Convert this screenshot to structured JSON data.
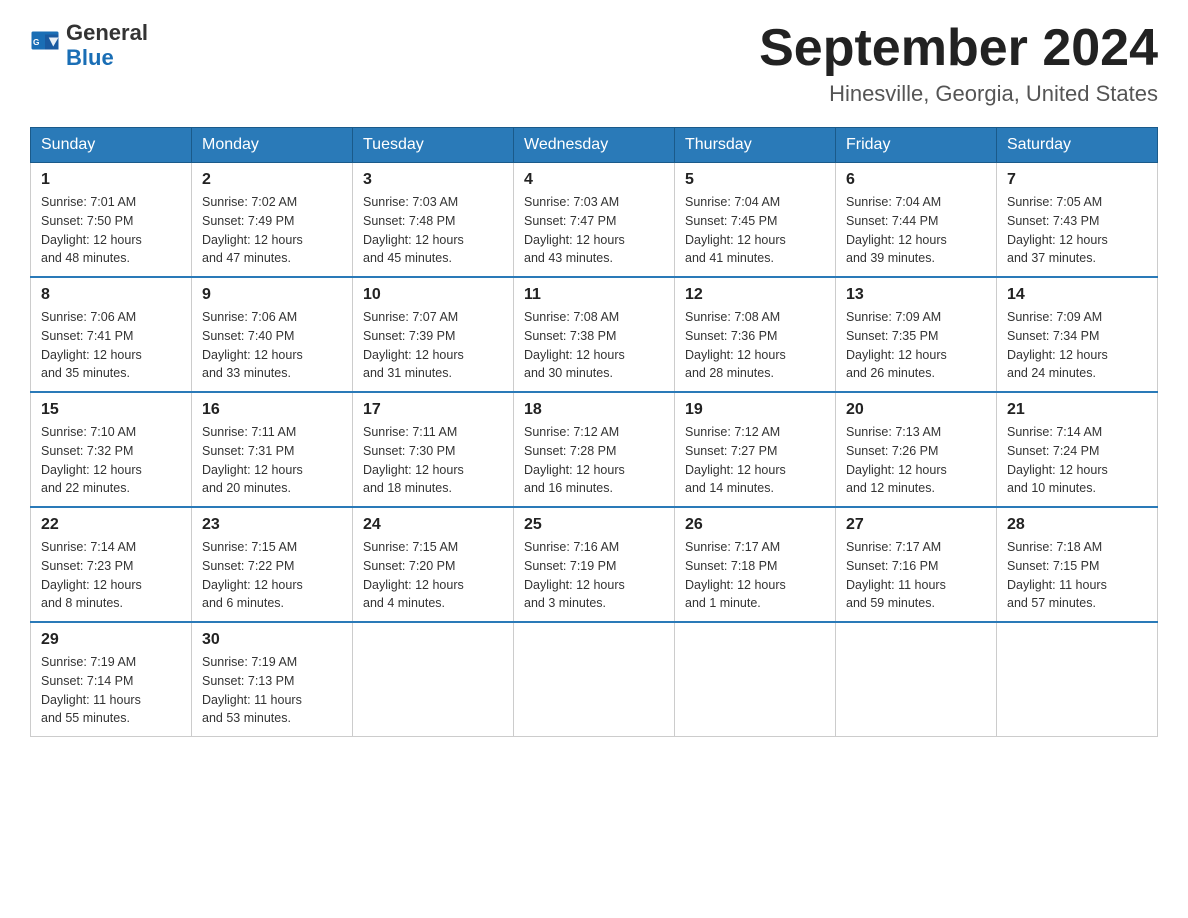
{
  "header": {
    "logo_line1": "General",
    "logo_line2": "Blue",
    "calendar_title": "September 2024",
    "calendar_subtitle": "Hinesville, Georgia, United States"
  },
  "days_of_week": [
    "Sunday",
    "Monday",
    "Tuesday",
    "Wednesday",
    "Thursday",
    "Friday",
    "Saturday"
  ],
  "weeks": [
    [
      {
        "day": "1",
        "sunrise": "7:01 AM",
        "sunset": "7:50 PM",
        "daylight": "12 hours and 48 minutes."
      },
      {
        "day": "2",
        "sunrise": "7:02 AM",
        "sunset": "7:49 PM",
        "daylight": "12 hours and 47 minutes."
      },
      {
        "day": "3",
        "sunrise": "7:03 AM",
        "sunset": "7:48 PM",
        "daylight": "12 hours and 45 minutes."
      },
      {
        "day": "4",
        "sunrise": "7:03 AM",
        "sunset": "7:47 PM",
        "daylight": "12 hours and 43 minutes."
      },
      {
        "day": "5",
        "sunrise": "7:04 AM",
        "sunset": "7:45 PM",
        "daylight": "12 hours and 41 minutes."
      },
      {
        "day": "6",
        "sunrise": "7:04 AM",
        "sunset": "7:44 PM",
        "daylight": "12 hours and 39 minutes."
      },
      {
        "day": "7",
        "sunrise": "7:05 AM",
        "sunset": "7:43 PM",
        "daylight": "12 hours and 37 minutes."
      }
    ],
    [
      {
        "day": "8",
        "sunrise": "7:06 AM",
        "sunset": "7:41 PM",
        "daylight": "12 hours and 35 minutes."
      },
      {
        "day": "9",
        "sunrise": "7:06 AM",
        "sunset": "7:40 PM",
        "daylight": "12 hours and 33 minutes."
      },
      {
        "day": "10",
        "sunrise": "7:07 AM",
        "sunset": "7:39 PM",
        "daylight": "12 hours and 31 minutes."
      },
      {
        "day": "11",
        "sunrise": "7:08 AM",
        "sunset": "7:38 PM",
        "daylight": "12 hours and 30 minutes."
      },
      {
        "day": "12",
        "sunrise": "7:08 AM",
        "sunset": "7:36 PM",
        "daylight": "12 hours and 28 minutes."
      },
      {
        "day": "13",
        "sunrise": "7:09 AM",
        "sunset": "7:35 PM",
        "daylight": "12 hours and 26 minutes."
      },
      {
        "day": "14",
        "sunrise": "7:09 AM",
        "sunset": "7:34 PM",
        "daylight": "12 hours and 24 minutes."
      }
    ],
    [
      {
        "day": "15",
        "sunrise": "7:10 AM",
        "sunset": "7:32 PM",
        "daylight": "12 hours and 22 minutes."
      },
      {
        "day": "16",
        "sunrise": "7:11 AM",
        "sunset": "7:31 PM",
        "daylight": "12 hours and 20 minutes."
      },
      {
        "day": "17",
        "sunrise": "7:11 AM",
        "sunset": "7:30 PM",
        "daylight": "12 hours and 18 minutes."
      },
      {
        "day": "18",
        "sunrise": "7:12 AM",
        "sunset": "7:28 PM",
        "daylight": "12 hours and 16 minutes."
      },
      {
        "day": "19",
        "sunrise": "7:12 AM",
        "sunset": "7:27 PM",
        "daylight": "12 hours and 14 minutes."
      },
      {
        "day": "20",
        "sunrise": "7:13 AM",
        "sunset": "7:26 PM",
        "daylight": "12 hours and 12 minutes."
      },
      {
        "day": "21",
        "sunrise": "7:14 AM",
        "sunset": "7:24 PM",
        "daylight": "12 hours and 10 minutes."
      }
    ],
    [
      {
        "day": "22",
        "sunrise": "7:14 AM",
        "sunset": "7:23 PM",
        "daylight": "12 hours and 8 minutes."
      },
      {
        "day": "23",
        "sunrise": "7:15 AM",
        "sunset": "7:22 PM",
        "daylight": "12 hours and 6 minutes."
      },
      {
        "day": "24",
        "sunrise": "7:15 AM",
        "sunset": "7:20 PM",
        "daylight": "12 hours and 4 minutes."
      },
      {
        "day": "25",
        "sunrise": "7:16 AM",
        "sunset": "7:19 PM",
        "daylight": "12 hours and 3 minutes."
      },
      {
        "day": "26",
        "sunrise": "7:17 AM",
        "sunset": "7:18 PM",
        "daylight": "12 hours and 1 minute."
      },
      {
        "day": "27",
        "sunrise": "7:17 AM",
        "sunset": "7:16 PM",
        "daylight": "11 hours and 59 minutes."
      },
      {
        "day": "28",
        "sunrise": "7:18 AM",
        "sunset": "7:15 PM",
        "daylight": "11 hours and 57 minutes."
      }
    ],
    [
      {
        "day": "29",
        "sunrise": "7:19 AM",
        "sunset": "7:14 PM",
        "daylight": "11 hours and 55 minutes."
      },
      {
        "day": "30",
        "sunrise": "7:19 AM",
        "sunset": "7:13 PM",
        "daylight": "11 hours and 53 minutes."
      },
      null,
      null,
      null,
      null,
      null
    ]
  ],
  "labels": {
    "sunrise": "Sunrise:",
    "sunset": "Sunset:",
    "daylight": "Daylight:"
  }
}
